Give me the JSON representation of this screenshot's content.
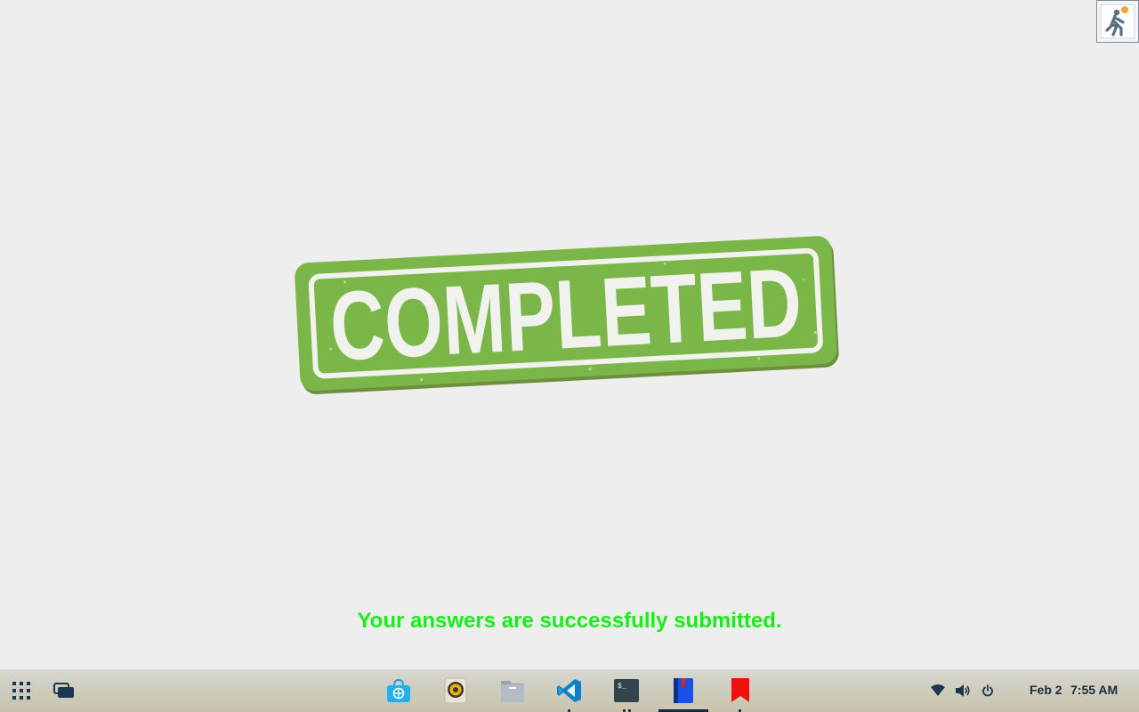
{
  "stamp": {
    "text": "COMPLETED",
    "color": "#7ab648"
  },
  "message": {
    "text": "Your answers are successfully submitted.",
    "color": "#16ee16"
  },
  "taskbar": {
    "apps": [
      {
        "name": "app-store",
        "icon": "shopping-bag-icon"
      },
      {
        "name": "music-player",
        "icon": "speaker-icon"
      },
      {
        "name": "files",
        "icon": "folder-icon"
      },
      {
        "name": "vscode",
        "icon": "vscode-icon"
      },
      {
        "name": "terminal",
        "icon": "terminal-icon"
      },
      {
        "name": "notebook",
        "icon": "notebook-icon"
      },
      {
        "name": "bookmarks",
        "icon": "bookmark-icon"
      }
    ],
    "tray": {
      "date": "Feb 2",
      "time": "7:55 AM"
    }
  }
}
